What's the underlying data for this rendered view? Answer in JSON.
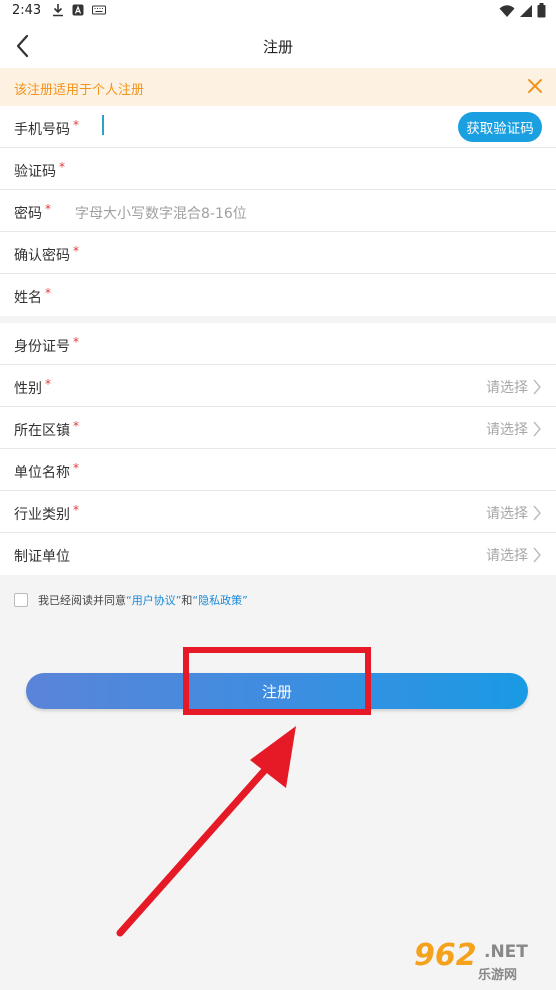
{
  "status": {
    "time": "2:43"
  },
  "header": {
    "title": "注册"
  },
  "notice": {
    "text": "该注册适用于个人注册"
  },
  "form": {
    "phone_label": "手机号码",
    "get_code_label": "获取验证码",
    "code_label": "验证码",
    "password_label": "密码",
    "password_placeholder": "字母大小写数字混合8-16位",
    "confirm_label": "确认密码",
    "name_label": "姓名",
    "id_label": "身份证号",
    "gender_label": "性别",
    "district_label": "所在区镇",
    "company_label": "单位名称",
    "industry_label": "行业类别",
    "issuer_label": "制证单位",
    "select_placeholder": "请选择",
    "required_mark": "*"
  },
  "agreement": {
    "prefix": "我已经阅读并同意",
    "user_agreement": "“用户协议”",
    "and": "和",
    "privacy_policy": "“隐私政策”"
  },
  "register_button": "注册",
  "watermark": {
    "brand": "962",
    "domain": ".NET",
    "name": "乐游网"
  },
  "colors": {
    "accent": "#1a9fe0",
    "warning": "#f2941c",
    "required": "#e23b3b",
    "annotation": "#e51a26"
  }
}
